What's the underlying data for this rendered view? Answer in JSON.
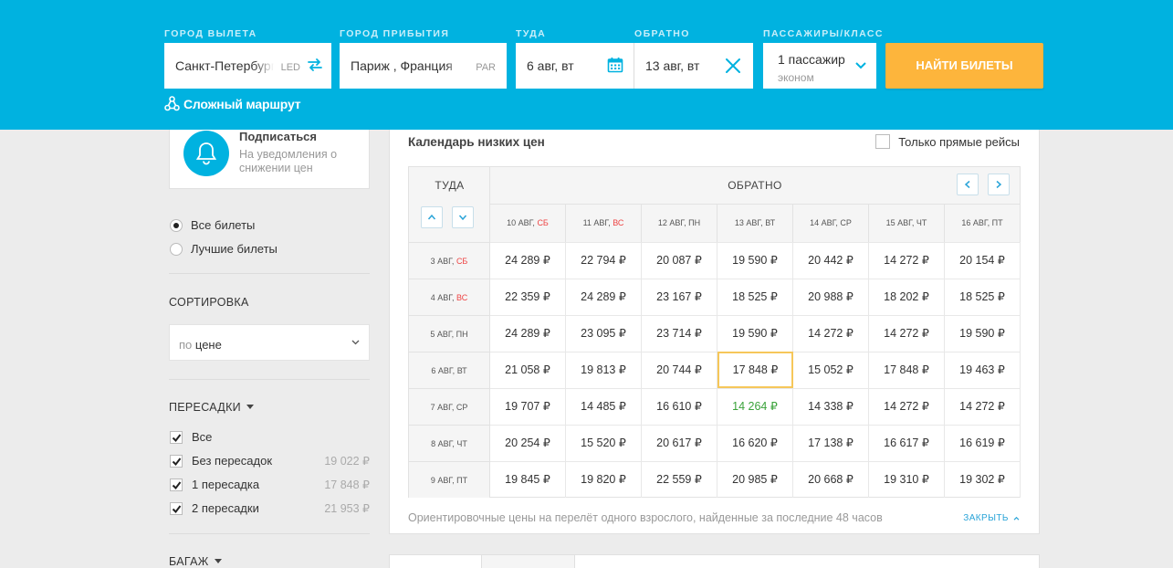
{
  "search": {
    "origin": {
      "label": "ГОРОД ВЫЛЕТА",
      "value": "Санкт-Петербург",
      "iata": "LED"
    },
    "destination": {
      "label": "ГОРОД ПРИБЫТИЯ",
      "value": "Париж , Франция",
      "iata": "PAR"
    },
    "depart": {
      "label": "ТУДА",
      "value": "6 авг, вт"
    },
    "return": {
      "label": "ОБРАТНО",
      "value": "13 авг, вт"
    },
    "passengers": {
      "label": "ПАССАЖИРЫ/КЛАСС",
      "value": "1 пассажир",
      "class": "эконом"
    },
    "find_button": "НАЙТИ БИЛЕТЫ",
    "complex_route": "Сложный маршрут",
    "accent_color": "#00b2e0",
    "button_color": "#fdb53c"
  },
  "sidebar": {
    "subscribe": {
      "title": "Подписаться",
      "text": "На уведомления о снижении цен"
    },
    "radios": [
      {
        "label": "Все билеты",
        "checked": true
      },
      {
        "label": "Лучшие билеты",
        "checked": false
      }
    ],
    "sort": {
      "title": "СОРТИРОВКА",
      "prefix": "по",
      "value": "цене"
    },
    "stops": {
      "title": "ПЕРЕСАДКИ",
      "items": [
        {
          "label": "Все",
          "price": "",
          "checked": true
        },
        {
          "label": "Без пересадок",
          "price": "19 022 ₽",
          "checked": true
        },
        {
          "label": "1 пересадка",
          "price": "17 848 ₽",
          "checked": true
        },
        {
          "label": "2 пересадки",
          "price": "21 953 ₽",
          "checked": true
        }
      ]
    },
    "baggage": {
      "title": "БАГАЖ"
    }
  },
  "calendar": {
    "title": "Календарь низких цен",
    "direct_only": "Только прямые рейсы",
    "depart_header": "ТУДА",
    "return_header": "ОБРАТНО",
    "return_dates": [
      {
        "date": "10 АВГ, ",
        "day": "СБ",
        "weekend": true
      },
      {
        "date": "11 АВГ, ",
        "day": "ВС",
        "weekend": true
      },
      {
        "date": "12 АВГ, ",
        "day": "ПН",
        "weekend": false
      },
      {
        "date": "13 АВГ, ",
        "day": "ВТ",
        "weekend": false
      },
      {
        "date": "14 АВГ, ",
        "day": "СР",
        "weekend": false
      },
      {
        "date": "15 АВГ, ",
        "day": "ЧТ",
        "weekend": false
      },
      {
        "date": "16 АВГ, ",
        "day": "ПТ",
        "weekend": false
      }
    ],
    "rows": [
      {
        "date": "3 АВГ, ",
        "day": "СБ",
        "weekend": true,
        "prices": [
          "24 289 ₽",
          "22 794 ₽",
          "20 087 ₽",
          "19 590 ₽",
          "20 442 ₽",
          "14 272 ₽",
          "20 154 ₽"
        ]
      },
      {
        "date": "4 АВГ, ",
        "day": "ВС",
        "weekend": true,
        "prices": [
          "22 359 ₽",
          "24 289 ₽",
          "23 167 ₽",
          "18 525 ₽",
          "20 988 ₽",
          "18 202 ₽",
          "18 525 ₽"
        ]
      },
      {
        "date": "5 АВГ, ",
        "day": "ПН",
        "weekend": false,
        "prices": [
          "24 289 ₽",
          "23 095 ₽",
          "23 714 ₽",
          "19 590 ₽",
          "14 272 ₽",
          "14 272 ₽",
          "19 590 ₽"
        ]
      },
      {
        "date": "6 АВГ, ",
        "day": "ВТ",
        "weekend": false,
        "prices": [
          "21 058 ₽",
          "19 813 ₽",
          "20 744 ₽",
          "17 848 ₽",
          "15 052 ₽",
          "17 848 ₽",
          "19 463 ₽"
        ]
      },
      {
        "date": "7 АВГ, ",
        "day": "СР",
        "weekend": false,
        "prices": [
          "19 707 ₽",
          "14 485 ₽",
          "16 610 ₽",
          "14 264 ₽",
          "14 338 ₽",
          "14 272 ₽",
          "14 272 ₽"
        ]
      },
      {
        "date": "8 АВГ, ",
        "day": "ЧТ",
        "weekend": false,
        "prices": [
          "20 254 ₽",
          "15 520 ₽",
          "20 617 ₽",
          "16 620 ₽",
          "17 138 ₽",
          "16 617 ₽",
          "16 619 ₽"
        ]
      },
      {
        "date": "9 АВГ, ",
        "day": "ПТ",
        "weekend": false,
        "prices": [
          "19 845 ₽",
          "19 820 ₽",
          "22 559 ₽",
          "20 985 ₽",
          "20 668 ₽",
          "19 310 ₽",
          "19 302 ₽"
        ]
      }
    ],
    "selected": {
      "row": 3,
      "col": 3
    },
    "cheapest": {
      "row": 4,
      "col": 3
    },
    "note": "Ориентировочные цены на перелёт одного взрослого, найденные за последние 48 часов",
    "close": "ЗАКРЫТЬ"
  }
}
